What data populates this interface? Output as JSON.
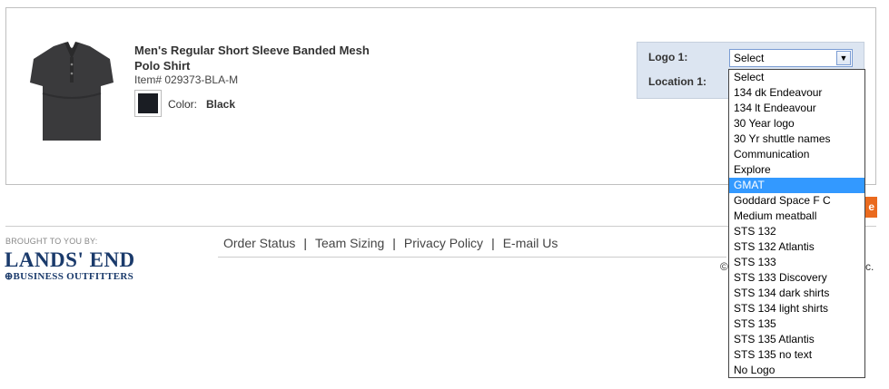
{
  "product": {
    "name": "Men's Regular Short Sleeve Banded Mesh Polo Shirt",
    "item_number": "Item# 029373-BLA-M",
    "color_label": "Color:",
    "color_value": "Black",
    "swatch_color": "#1a1d23"
  },
  "logo_panel": {
    "logo_label": "Logo 1:",
    "location_label": "Location 1:",
    "selected_value": "Select",
    "options": [
      "Select",
      "134 dk Endeavour",
      "134 lt Endeavour",
      "30 Year logo",
      "30 Yr shuttle names",
      "Communication",
      "Explore",
      "GMAT",
      "Goddard Space F C",
      "Medium meatball",
      "STS 132",
      "STS 132 Atlantis",
      "STS 133",
      "STS 133 Discovery",
      "STS 134 dark shirts",
      "STS 134 light shirts",
      "STS 135",
      "STS 135 Atlantis",
      "STS 135 no text",
      "No Logo"
    ],
    "highlighted_option": "GMAT"
  },
  "partial_button_text": "e",
  "footer": {
    "brought_to_you": "BROUGHT TO YOU BY:",
    "brand_name": "LANDS' END",
    "brand_sub": "BUSINESS OUTFITTERS",
    "links": [
      "Order Status",
      "Team Sizing",
      "Privacy Policy",
      "E-mail Us"
    ],
    "copyright_left": "©",
    "copyright_right": "c."
  },
  "colors": {
    "accent_orange": "#ea6a1e",
    "panel_blue": "#dce5f1",
    "highlight_blue": "#3399ff",
    "brand_navy": "#1a3a6b"
  }
}
